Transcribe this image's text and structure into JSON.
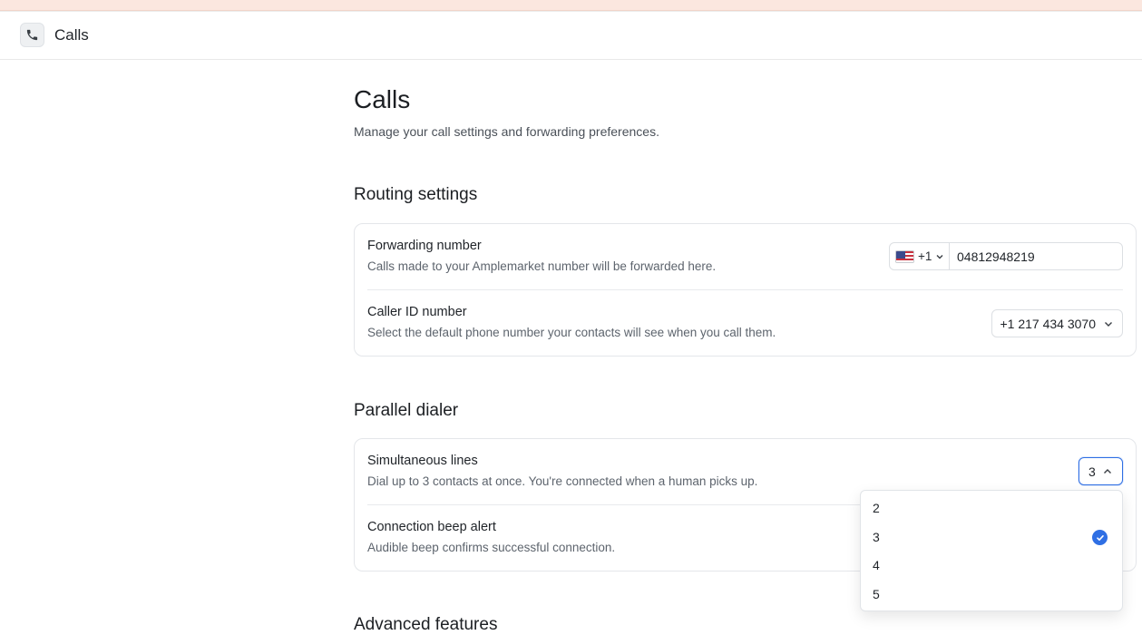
{
  "header": {
    "title": "Calls",
    "icon": "phone-icon"
  },
  "page": {
    "title": "Calls",
    "subtitle": "Manage your call settings and forwarding preferences."
  },
  "routing": {
    "section_title": "Routing settings",
    "forwarding": {
      "title": "Forwarding number",
      "description": "Calls made to your Amplemarket number will be forwarded here.",
      "country_code": "+1",
      "number": "04812948219"
    },
    "caller_id": {
      "title": "Caller ID number",
      "description": "Select the default phone number your contacts will see when you call them.",
      "value": "+1 217 434 3070"
    }
  },
  "parallel": {
    "section_title": "Parallel dialer",
    "lines": {
      "title": "Simultaneous lines",
      "description": "Dial up to 3 contacts at once. You're connected when a human picks up.",
      "value": "3",
      "options": [
        "2",
        "3",
        "4",
        "5"
      ],
      "selected": "3"
    },
    "beep": {
      "title": "Connection beep alert",
      "description": "Audible beep confirms successful connection."
    }
  },
  "advanced": {
    "section_title": "Advanced features"
  },
  "colors": {
    "accent": "#2f6fe4",
    "top_strip": "#fbe7df"
  }
}
